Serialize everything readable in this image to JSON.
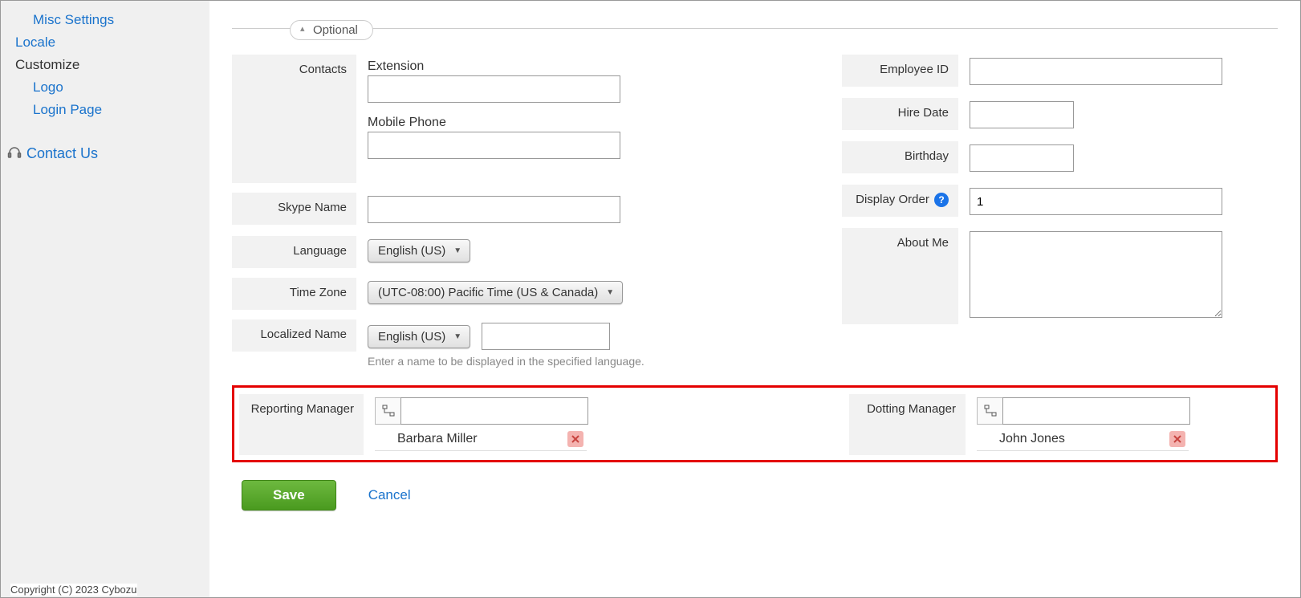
{
  "sidebar": {
    "misc_settings": "Misc Settings",
    "locale": "Locale",
    "customize": "Customize",
    "logo": "Logo",
    "login_page": "Login Page",
    "contact_us": "Contact Us"
  },
  "fieldset": {
    "title": "Optional"
  },
  "labels": {
    "contacts": "Contacts",
    "extension": "Extension",
    "mobile_phone": "Mobile Phone",
    "skype": "Skype Name",
    "language": "Language",
    "timezone": "Time Zone",
    "localized_name": "Localized Name",
    "localized_hint": "Enter a name to be displayed in the specified language.",
    "employee_id": "Employee ID",
    "hire_date": "Hire Date",
    "birthday": "Birthday",
    "display_order": "Display Order",
    "about_me": "About Me",
    "reporting_manager": "Reporting Manager",
    "dotting_manager": "Dotting Manager"
  },
  "values": {
    "extension": "",
    "mobile_phone": "",
    "skype": "",
    "language": "English (US)",
    "timezone": "(UTC-08:00) Pacific Time (US & Canada)",
    "localized_lang": "English (US)",
    "localized_name": "",
    "employee_id": "",
    "hire_date": "",
    "birthday": "",
    "display_order": "1",
    "about_me": "",
    "reporting_manager_search": "",
    "reporting_manager_selected": "Barbara Miller",
    "dotting_manager_search": "",
    "dotting_manager_selected": "John Jones"
  },
  "buttons": {
    "save": "Save",
    "cancel": "Cancel"
  },
  "footer": {
    "copyright": "Copyright (C) 2023 Cybozu"
  }
}
